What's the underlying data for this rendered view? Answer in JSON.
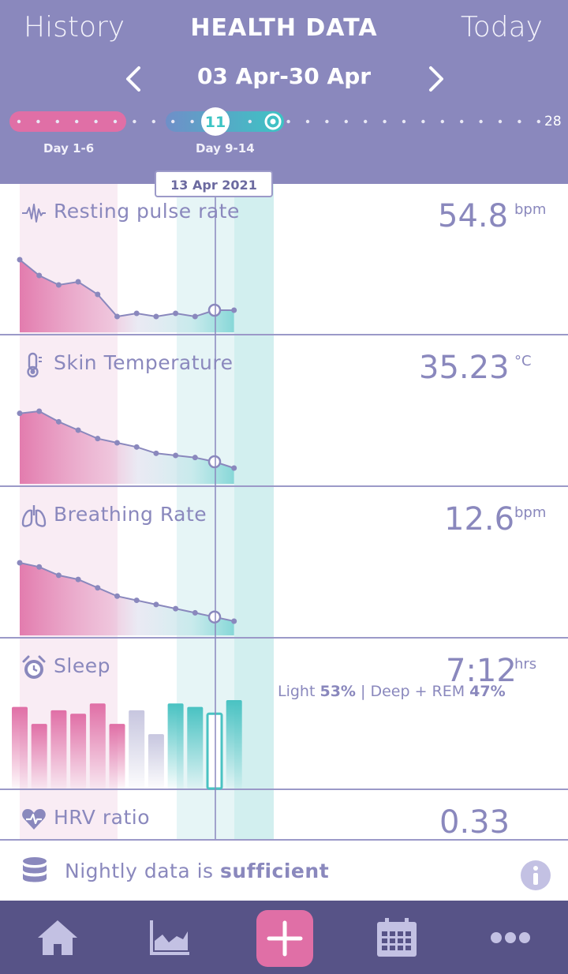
{
  "header": {
    "left_link": "History",
    "title": "HEALTH DATA",
    "right_link": "Today",
    "date_range": "03 Apr-30 Apr",
    "prev_icon": "chevron-left-icon",
    "next_icon": "chevron-right-icon"
  },
  "timeline": {
    "current_day": "11",
    "end_day": "28",
    "period_1_label": "Day 1-6",
    "period_2_label": "Day 9-14",
    "selected_date": "13 Apr 2021"
  },
  "metrics": [
    {
      "title": "Resting pulse rate",
      "value": "54.8",
      "unit": "bpm",
      "icon": "pulse-icon"
    },
    {
      "title": "Skin Temperature",
      "value": "35.23",
      "unit": "°C",
      "icon": "thermometer-icon"
    },
    {
      "title": "Breathing Rate",
      "value": "12.6",
      "unit": "bpm",
      "icon": "lungs-icon"
    },
    {
      "title": "Sleep",
      "value": "7:12",
      "unit": "hrs",
      "icon": "alarm-clock-icon"
    },
    {
      "title": "HRV ratio",
      "value": "0.33",
      "unit": "",
      "icon": "heart-rate-icon"
    }
  ],
  "sleep": {
    "light_label": "Light",
    "light_pct": "53%",
    "separator": "|",
    "deep_label": "Deep + REM",
    "deep_pct": "47%"
  },
  "status": {
    "text_prefix": "Nightly data is",
    "text_emphasis": "sufficient",
    "icon": "database-icon",
    "info_icon": "info-icon"
  },
  "nav": [
    {
      "name": "home",
      "icon": "home-icon"
    },
    {
      "name": "trends",
      "icon": "area-chart-icon"
    },
    {
      "name": "add",
      "icon": "plus-icon"
    },
    {
      "name": "calendar",
      "icon": "calendar-icon"
    },
    {
      "name": "more",
      "icon": "more-icon"
    }
  ],
  "colors": {
    "header": "#8a88bd",
    "nav": "#575387",
    "pink": "#e06fa6",
    "teal": "#3cc4c4",
    "line": "#8a88bd"
  },
  "chart_data": [
    {
      "type": "area",
      "title": "Resting pulse rate",
      "days": [
        1,
        2,
        3,
        4,
        5,
        6,
        7,
        8,
        9,
        10,
        11,
        12
      ],
      "values": [
        56.4,
        55.9,
        55.6,
        55.7,
        55.3,
        54.6,
        54.7,
        54.6,
        54.7,
        54.6,
        54.8,
        54.8
      ]
    },
    {
      "type": "area",
      "title": "Skin Temperature",
      "days": [
        1,
        2,
        3,
        4,
        5,
        6,
        7,
        8,
        9,
        10,
        11,
        12
      ],
      "values": [
        35.46,
        35.47,
        35.42,
        35.38,
        35.34,
        35.32,
        35.3,
        35.27,
        35.26,
        35.25,
        35.23,
        35.2
      ]
    },
    {
      "type": "area",
      "title": "Breathing Rate",
      "days": [
        1,
        2,
        3,
        4,
        5,
        6,
        7,
        8,
        9,
        10,
        11,
        12
      ],
      "values": [
        13.6,
        13.5,
        13.3,
        13.2,
        13.0,
        12.8,
        12.7,
        12.6,
        12.5,
        12.4,
        12.3,
        12.2
      ]
    },
    {
      "type": "bar",
      "title": "Sleep",
      "days": [
        1,
        2,
        3,
        4,
        5,
        6,
        7,
        8,
        9,
        10,
        11,
        12
      ],
      "values": [
        7.4,
        6.9,
        7.3,
        7.2,
        7.5,
        6.9,
        7.3,
        6.6,
        7.5,
        7.4,
        7.2,
        7.6
      ]
    }
  ]
}
